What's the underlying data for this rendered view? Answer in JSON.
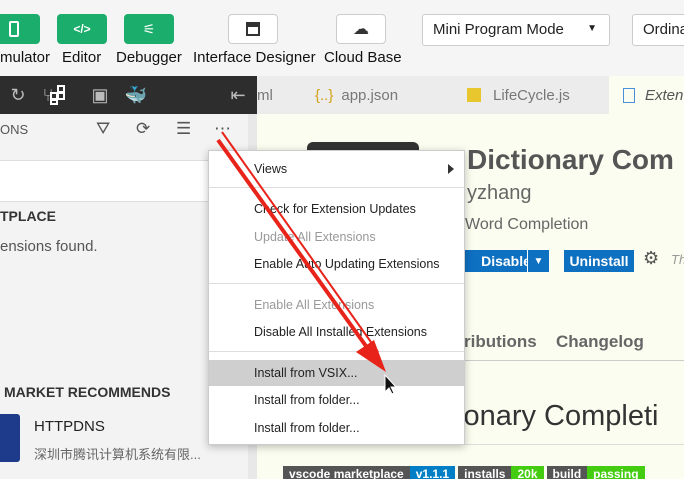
{
  "toolbar": {
    "simulator_label": "mulator",
    "editor_label": "Editor",
    "debugger_label": "Debugger",
    "designer_label": "Interface Designer",
    "cloud_label": "Cloud Base",
    "mode_value": "Mini Program Mode",
    "ordinary_value": "Ordina"
  },
  "sidebar": {
    "title": "ONS",
    "marketplace_heading": "TPLACE",
    "no_results": "ensions found.",
    "recommends_heading": "MARKET RECOMMENDS",
    "rec_item": {
      "name": "HTTPDNS",
      "desc": "深圳市腾讯计算机系统有限..."
    }
  },
  "tabs": [
    {
      "label": "ml"
    },
    {
      "label": "app.json",
      "icon": "{..}"
    },
    {
      "label": "LifeCycle.js",
      "icon": "JS"
    },
    {
      "label": "Exten"
    }
  ],
  "extension": {
    "title": "Dictionary Com",
    "author": "yzhang",
    "description": "Word Completion",
    "disable_label": "Disable",
    "uninstall_label": "Uninstall",
    "gear_hint": "Th",
    "tab_contributions": "ributions",
    "tab_changelog": "Changelog",
    "heading": "ionary Completi",
    "badges": [
      {
        "left": "vscode marketplace",
        "right": "v1.1.1"
      },
      {
        "left": "installs",
        "right": "20k"
      },
      {
        "left": "build",
        "right": "passing"
      }
    ]
  },
  "menu": {
    "views": "Views",
    "check_updates": "Check for Extension Updates",
    "update_all": "Update All Extensions",
    "enable_auto": "Enable Auto Updating Extensions",
    "enable_all": "Enable All Extensions",
    "disable_all": "Disable All Installed Extensions",
    "install_vsix": "Install from VSIX...",
    "install_folder_1": "Install from folder...",
    "install_folder_2": "Install from folder..."
  },
  "colors": {
    "accent_green": "#1aad6c",
    "button_blue": "#0e70c0",
    "annotation_red": "#e8231a"
  }
}
